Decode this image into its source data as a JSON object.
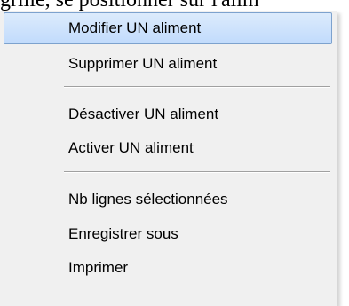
{
  "background": {
    "text": "grille, se positionner sur l'alim"
  },
  "menu": {
    "items": [
      {
        "label": "Modifier UN aliment"
      },
      {
        "label": "Supprimer UN aliment"
      },
      {
        "label": "Désactiver UN aliment"
      },
      {
        "label": "Activer UN aliment"
      },
      {
        "label": "Nb lignes sélectionnées"
      },
      {
        "label": "Enregistrer sous"
      },
      {
        "label": "Imprimer"
      }
    ],
    "highlight_color": "#c1dbfc",
    "highlight_border": "#7da2ce"
  }
}
